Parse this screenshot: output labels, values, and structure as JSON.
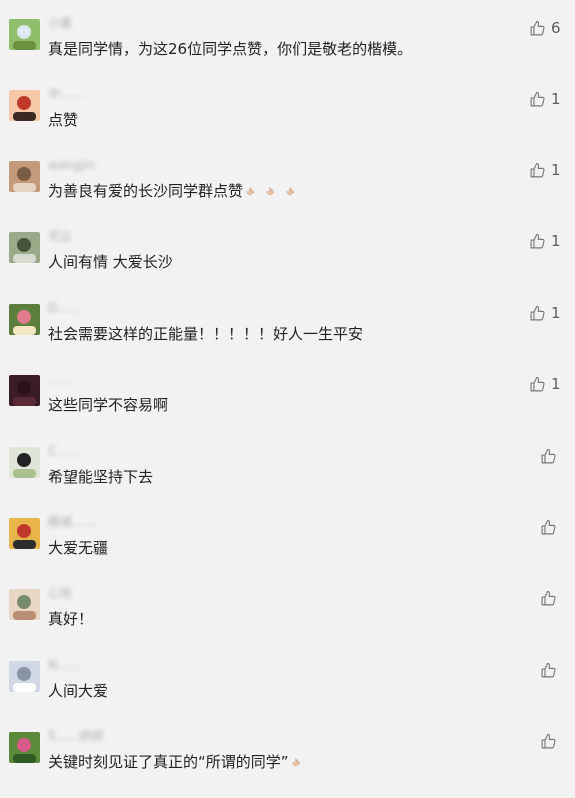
{
  "comments": [
    {
      "nickname": "小墨",
      "text": "真是同学情，为这26位同学点赞，你们是敬老的楷模。",
      "likes": "6",
      "avatar_colors": [
        "#8fbf6a",
        "#dfe9f2",
        "#6d8f3f"
      ],
      "text_emoji_count": 0
    },
    {
      "nickname": "中……",
      "text": "点赞",
      "likes": "1",
      "avatar_colors": [
        "#f6c8a8",
        "#c0392b",
        "#3a2a22"
      ],
      "text_emoji_count": 0
    },
    {
      "nickname": "wangjin",
      "text": "为善良有爱的长沙同学群点赞",
      "likes": "1",
      "avatar_colors": [
        "#c49b7a",
        "#7a5c43",
        "#e6d3c2"
      ],
      "text_emoji_count": 3
    },
    {
      "nickname": "无尘",
      "text": "人间有情 大爱长沙",
      "likes": "1",
      "avatar_colors": [
        "#9aaa88",
        "#46543c",
        "#d6dbd0"
      ],
      "text_emoji_count": 0
    },
    {
      "nickname": "D……",
      "text": "社会需要这样的正能量！！！！！好人一生平安",
      "likes": "1",
      "avatar_colors": [
        "#5b7e3b",
        "#e07b8c",
        "#f3e6c2"
      ],
      "text_emoji_count": 0
    },
    {
      "nickname": "……",
      "text": "这些同学不容易啊",
      "likes": "1",
      "avatar_colors": [
        "#3b1d26",
        "#2a1218",
        "#5a2a36"
      ],
      "text_emoji_count": 0
    },
    {
      "nickname": "C……",
      "text": "希望能坚持下去",
      "likes": "",
      "avatar_colors": [
        "#dfe6d8",
        "#222222",
        "#a9c08f"
      ],
      "text_emoji_count": 0
    },
    {
      "nickname": "精诚……",
      "text": "大爱无疆",
      "likes": "",
      "avatar_colors": [
        "#e8b54a",
        "#c0392b",
        "#2d2d2d"
      ],
      "text_emoji_count": 0
    },
    {
      "nickname": "心怡",
      "text": "真好！",
      "likes": "",
      "avatar_colors": [
        "#e9d7c6",
        "#7a8b6a",
        "#b98f74"
      ],
      "text_emoji_count": 0
    },
    {
      "nickname": "N……",
      "text": "人间大爱",
      "likes": "",
      "avatar_colors": [
        "#cfd8e4",
        "#8a95a8",
        "#ffffff"
      ],
      "text_emoji_count": 0
    },
    {
      "nickname": "S……妍妍",
      "text": "关键时刻见证了真正的“所谓的同学”",
      "likes": "",
      "avatar_colors": [
        "#5a8a3a",
        "#d85a8a",
        "#2f5a22"
      ],
      "text_emoji_count": 1
    }
  ],
  "icons": {
    "like": "thumbs-up-icon",
    "emoji": "clapping-hand-emoji"
  },
  "colors": {
    "background": "#f2f2f2",
    "text": "#222222",
    "muted": "#5e5e5e"
  }
}
